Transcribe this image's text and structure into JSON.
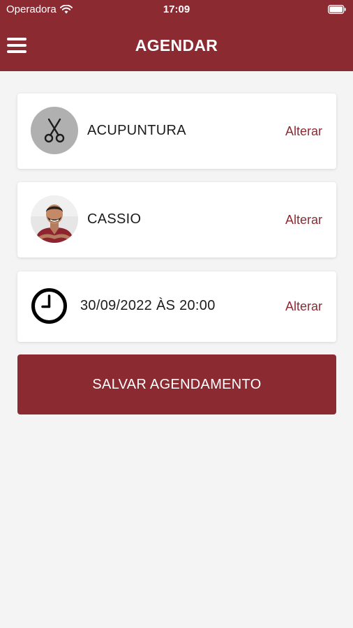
{
  "status_bar": {
    "carrier": "Operadora",
    "time": "17:09"
  },
  "header": {
    "title": "AGENDAR"
  },
  "appointment": {
    "service": {
      "name": "ACUPUNTURA",
      "change_label": "Alterar",
      "icon": "scissors-icon"
    },
    "professional": {
      "name": "CASSIO",
      "change_label": "Alterar"
    },
    "datetime": {
      "value": "30/09/2022 ÀS 20:00",
      "change_label": "Alterar",
      "icon": "clock-icon"
    }
  },
  "actions": {
    "save_label": "SALVAR AGENDAMENTO"
  },
  "colors": {
    "primary": "#8c2a32",
    "background": "#f4f4f4",
    "card": "#ffffff"
  }
}
